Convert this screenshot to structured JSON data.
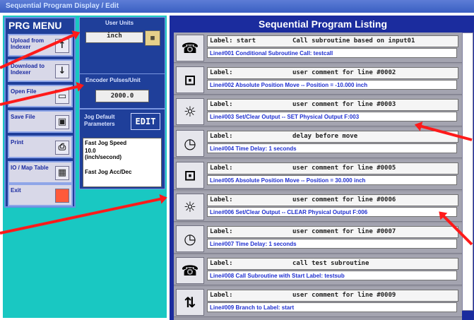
{
  "window": {
    "title": "Sequential Program Display / Edit"
  },
  "menu": {
    "title": "PRG MENU",
    "items": [
      {
        "label": "Upload from Indexer",
        "icon": "up-arrow-icon",
        "glyph": "↑"
      },
      {
        "label": "Download to Indexer",
        "icon": "down-arrow-icon",
        "glyph": "↓"
      },
      {
        "label": "Open File",
        "icon": "folder-icon",
        "glyph": "▭"
      },
      {
        "label": "Save File",
        "icon": "disk-icon",
        "glyph": "▣"
      },
      {
        "label": "Print",
        "icon": "printer-icon",
        "glyph": "⎙"
      },
      {
        "label": "IO / Map Table",
        "icon": "table-icon",
        "glyph": "▦"
      },
      {
        "label": "Exit",
        "icon": "exit-icon",
        "glyph": "■"
      }
    ]
  },
  "user_units": {
    "title": "User Units",
    "value": "inch"
  },
  "encoder": {
    "title": "Encoder Pulses/Unit",
    "value": "2000.0"
  },
  "jog": {
    "title": "Jog Default Parameters",
    "edit_label": "EDIT",
    "list": [
      "Fast Jog Speed",
      "10.0",
      "(inch/second)",
      "Fast Jog Acc/Dec"
    ]
  },
  "listing": {
    "title": "Sequential Program Listing",
    "rows": [
      {
        "icon": "subroutine-call-icon",
        "glyph": "☎",
        "label": "Label: start",
        "comment": "Call subroutine based on input01",
        "desc": "Line#001 Conditional Subroutine Call: testcall"
      },
      {
        "icon": "motor-move-icon",
        "glyph": "⊡",
        "label": "Label:",
        "comment": "user comment for line #0002",
        "desc": "Line#002 Absolute Position Move -- Position = -10.000 inch"
      },
      {
        "icon": "lightbulb-icon",
        "glyph": "☼",
        "label": "Label:",
        "comment": "user comment for line #0003",
        "desc": "Line#003 Set/Clear Output -- SET Physical Output F:003"
      },
      {
        "icon": "clock-icon",
        "glyph": "◷",
        "label": "Label:",
        "comment": "delay before move",
        "desc": "Line#004 Time Delay: 1 seconds"
      },
      {
        "icon": "motor-move-icon",
        "glyph": "⊡",
        "label": "Label:",
        "comment": "user comment for line #0005",
        "desc": "Line#005 Absolute Position Move -- Position = 30.000 inch"
      },
      {
        "icon": "lightbulb-icon",
        "glyph": "☼",
        "label": "Label:",
        "comment": "user comment for line #0006",
        "desc": "Line#006 Set/Clear Output -- CLEAR Physical Output F:006"
      },
      {
        "icon": "clock-icon",
        "glyph": "◷",
        "label": "Label:",
        "comment": "user comment for line #0007",
        "desc": "Line#007 Time Delay: 1 seconds"
      },
      {
        "icon": "subroutine-call-icon",
        "glyph": "☎",
        "label": "Label:",
        "comment": "call test subroutine",
        "desc": "Line#008 Call Subroutine with Start Label: testsub"
      },
      {
        "icon": "branch-icon",
        "glyph": "⇅",
        "label": "Label:",
        "comment": "user comment for line #0009",
        "desc": "Line#009 Branch to Label: start"
      }
    ]
  }
}
